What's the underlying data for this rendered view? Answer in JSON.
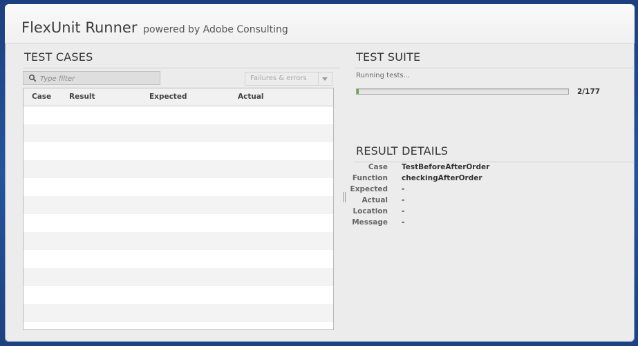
{
  "header": {
    "title": "FlexUnit Runner",
    "subtitle": "powered by Adobe Consulting"
  },
  "test_cases": {
    "title": "TEST CASES",
    "filter_placeholder": "Type filter",
    "filter_value": "",
    "filter_mode": "Failures & errors",
    "columns": [
      "Case",
      "Result",
      "Expected",
      "Actual"
    ],
    "rows": []
  },
  "test_suite": {
    "title": "TEST SUITE",
    "status": "Running tests...",
    "progress_label": "2/177",
    "progress_fraction": 0.0113,
    "progress_color": "#6aa84f"
  },
  "result_details": {
    "title": "RESULT DETAILS",
    "fields": [
      {
        "label": "Case",
        "value": "TestBeforeAfterOrder"
      },
      {
        "label": "Function",
        "value": "checkingAfterOrder"
      },
      {
        "label": "Expected",
        "value": "-"
      },
      {
        "label": "Actual",
        "value": "-"
      },
      {
        "label": "Location",
        "value": "-"
      },
      {
        "label": "Message",
        "value": "-"
      }
    ]
  }
}
